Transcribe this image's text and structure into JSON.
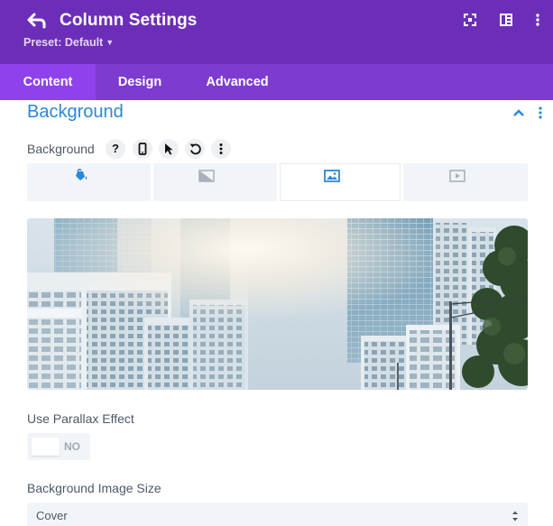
{
  "header": {
    "title": "Column Settings",
    "preset_label": "Preset: Default",
    "icons": [
      "back-icon",
      "fullscreen-icon",
      "split-view-icon",
      "more-icon"
    ]
  },
  "tabs": [
    {
      "label": "Content",
      "active": true
    },
    {
      "label": "Design",
      "active": false
    },
    {
      "label": "Advanced",
      "active": false
    }
  ],
  "section": {
    "title": "Background",
    "icons": [
      "chevron-up-icon",
      "more-vertical-icon"
    ]
  },
  "background_field": {
    "label": "Background",
    "tool_icons": [
      "help-icon",
      "mobile-icon",
      "pointer-icon",
      "reset-icon",
      "more-icon"
    ],
    "help_glyph": "?",
    "type_tabs": [
      {
        "name": "color",
        "icon": "paint-bucket-icon",
        "active": false
      },
      {
        "name": "gradient",
        "icon": "gradient-icon",
        "active": false
      },
      {
        "name": "image",
        "icon": "image-icon",
        "active": true
      },
      {
        "name": "video",
        "icon": "video-icon",
        "active": false
      }
    ]
  },
  "parallax": {
    "label": "Use Parallax Effect",
    "value": "NO"
  },
  "image_size": {
    "label": "Background Image Size",
    "value": "Cover"
  },
  "colors": {
    "header": "#6c2eb9",
    "tabs_bar": "#7e3bd0",
    "active_tab": "#8f42ec",
    "accent_blue": "#2b87da"
  }
}
